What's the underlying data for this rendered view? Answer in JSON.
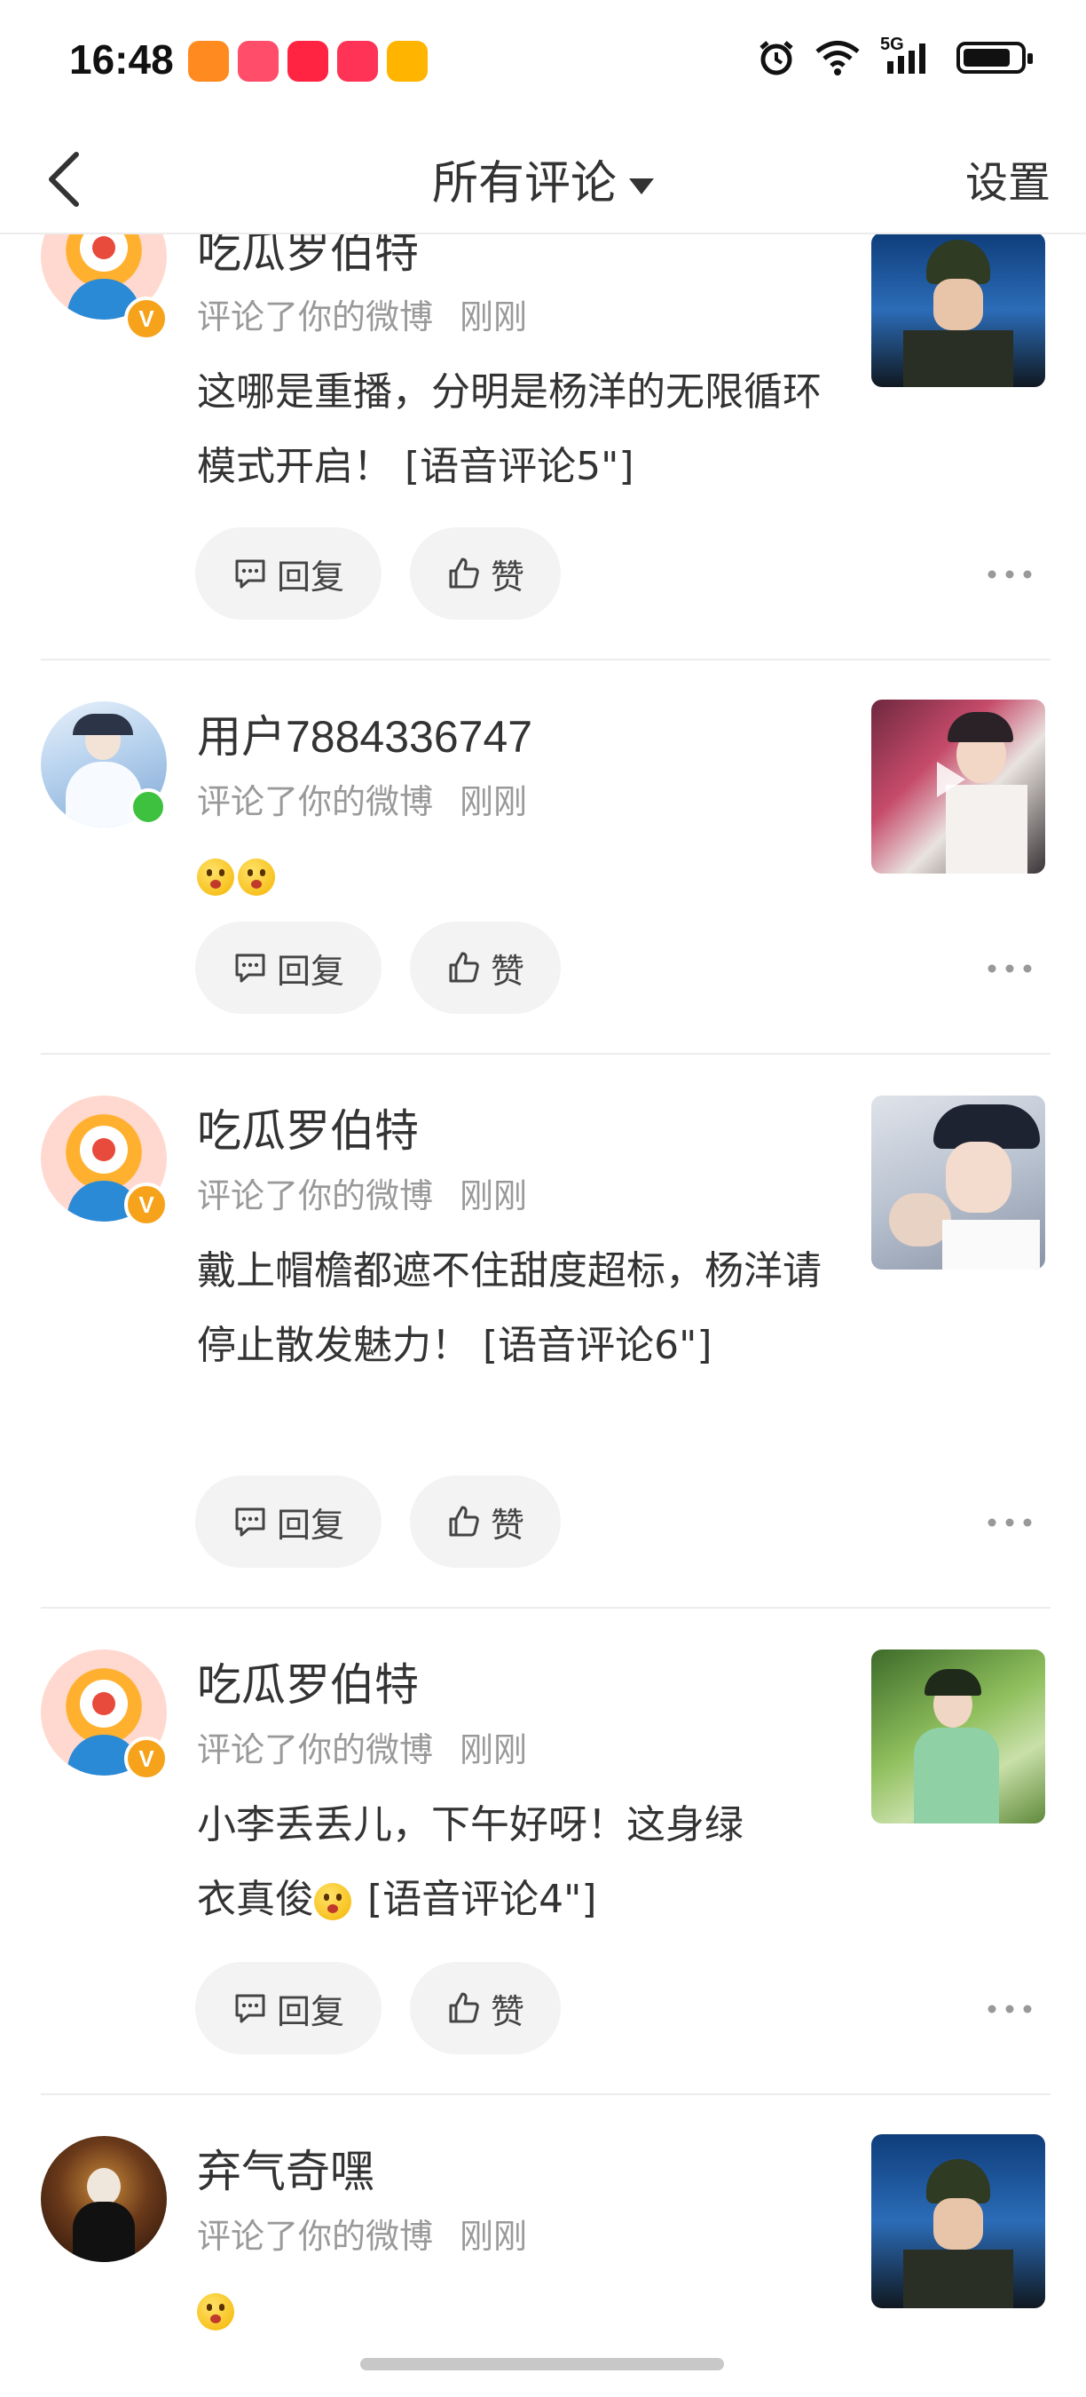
{
  "status_bar": {
    "time": "16:48",
    "network_label": "5G",
    "battery_level": 0.85
  },
  "nav": {
    "title": "所有评论",
    "settings_label": "设置"
  },
  "feed": {
    "items": [
      {
        "username": "吃瓜罗伯特",
        "action": "评论了你的微博",
        "time": "刚刚",
        "content": "这哪是重播，分明是杨洋的无限循环模式开启！ [语音评论5\"]",
        "reply_label": "回复",
        "like_label": "赞"
      },
      {
        "username": "用户7884336747",
        "action": "评论了你的微博",
        "time": "刚刚",
        "content": "",
        "reply_label": "回复",
        "like_label": "赞"
      },
      {
        "username": "吃瓜罗伯特",
        "action": "评论了你的微博",
        "time": "刚刚",
        "content": "戴上帽檐都遮不住甜度超标，杨洋请停止散发魅力！ [语音评论6\"]",
        "reply_label": "回复",
        "like_label": "赞"
      },
      {
        "username": "吃瓜罗伯特",
        "action": "评论了你的微博",
        "time": "刚刚",
        "content_before": "小李丢丢儿，下午好呀！这身绿",
        "content_after": "衣真俊",
        "content_tail": " [语音评论4\"]",
        "reply_label": "回复",
        "like_label": "赞"
      },
      {
        "username": "弃气奇嘿",
        "action": "评论了你的微博",
        "time": "刚刚",
        "content": ""
      }
    ]
  },
  "colors": {
    "verified_badge": "#f7a21b",
    "online_dot": "#3ec13e",
    "button_bg": "#f3f3f3",
    "secondary_text": "#999999"
  }
}
